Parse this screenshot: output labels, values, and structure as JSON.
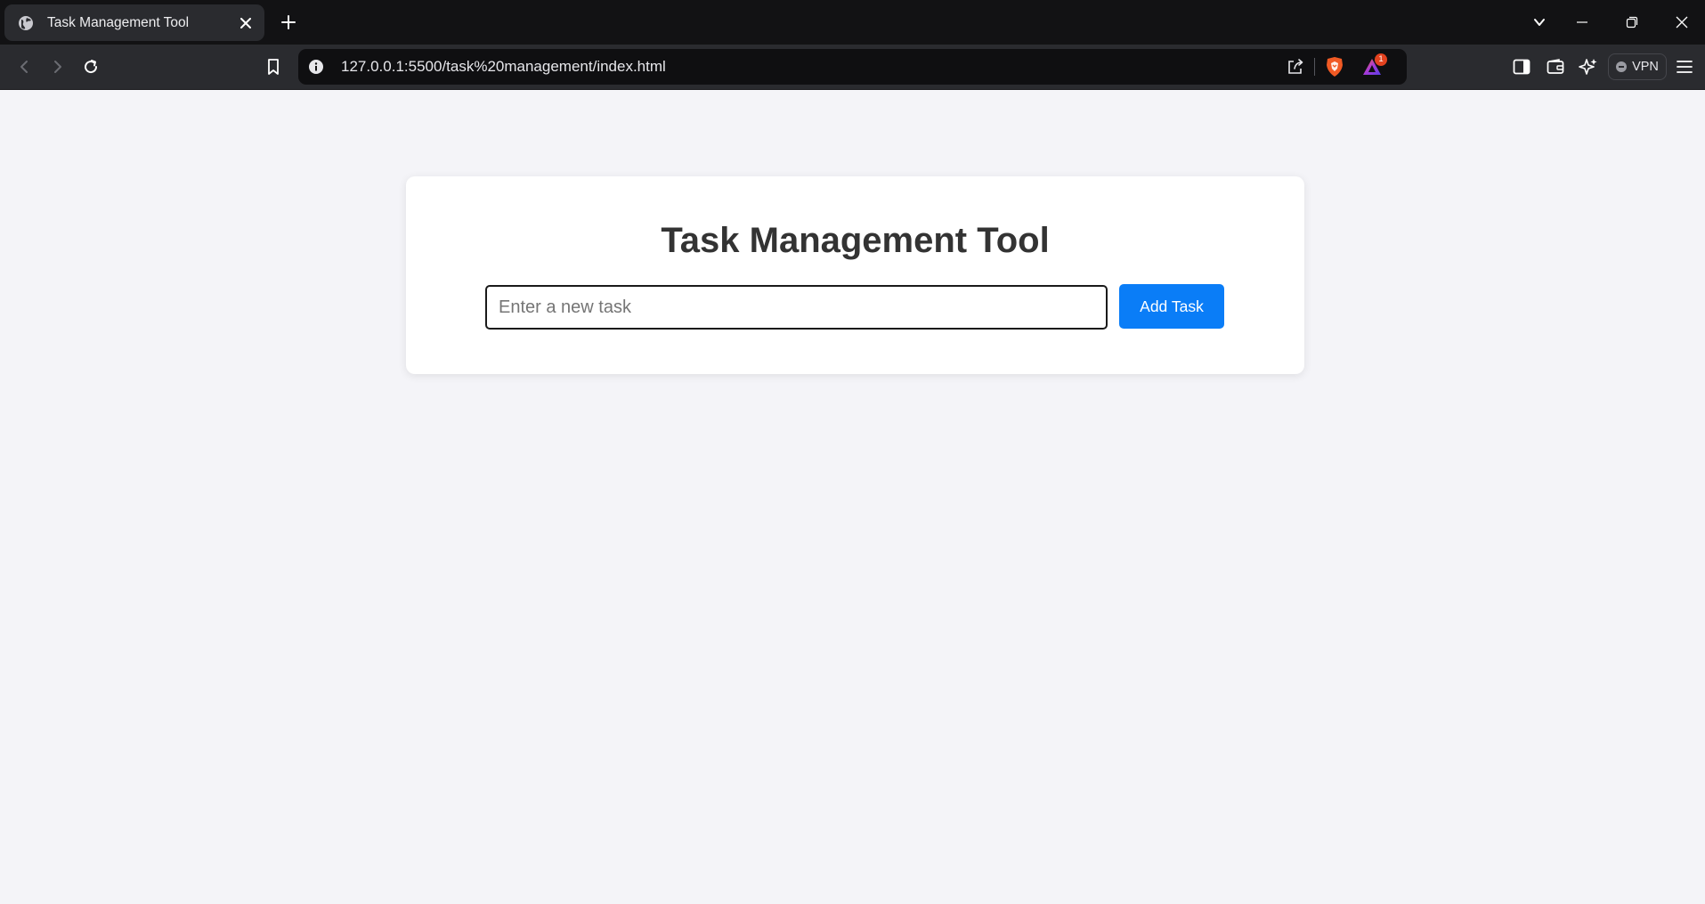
{
  "browser": {
    "tab": {
      "title": "Task Management Tool",
      "favicon": "globe-icon"
    },
    "url": "127.0.0.1:5500/task%20management/index.html",
    "rewards_badge_count": "1",
    "vpn_label": "VPN"
  },
  "page": {
    "heading": "Task Management Tool",
    "task_input": {
      "placeholder": "Enter a new task",
      "value": ""
    },
    "add_button_label": "Add Task",
    "tasks": []
  },
  "colors": {
    "page_background": "#f4f4f8",
    "card_background": "#ffffff",
    "heading_text": "#333333",
    "accent_button": "#0a7df7",
    "browser_chrome": "#2a2b2f",
    "tab_strip": "#121214"
  }
}
